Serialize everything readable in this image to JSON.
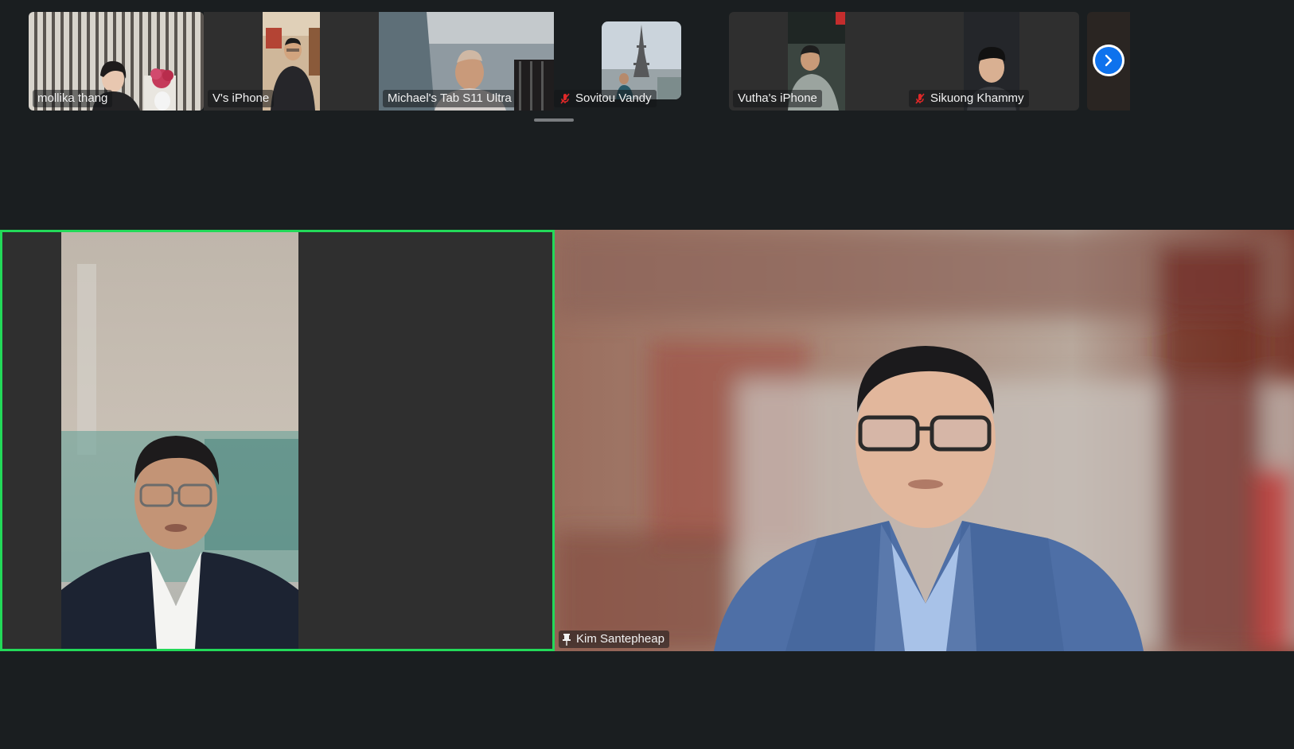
{
  "app": {
    "accent_color": "#0e72ed",
    "active_speaker_color": "#23d959",
    "mute_color": "#e02828"
  },
  "gallery_strip": {
    "participants": [
      {
        "name": "mollika thang",
        "muted": false
      },
      {
        "name": "V's iPhone",
        "muted": false
      },
      {
        "name": "Michael's Tab S11 Ultra",
        "muted": false
      },
      {
        "name": "Sovitou Vandy",
        "muted": true
      },
      {
        "name": "Vutha's iPhone",
        "muted": false
      },
      {
        "name": "Sikuong Khammy",
        "muted": true
      }
    ],
    "next_page_icon": "chevron-right-icon"
  },
  "main_view": {
    "speaker_tile": {
      "name": "",
      "active_speaker": true
    },
    "pinned_tile": {
      "name": "Kim Santepheap",
      "pinned": true,
      "pin_icon": "pin-icon"
    }
  }
}
